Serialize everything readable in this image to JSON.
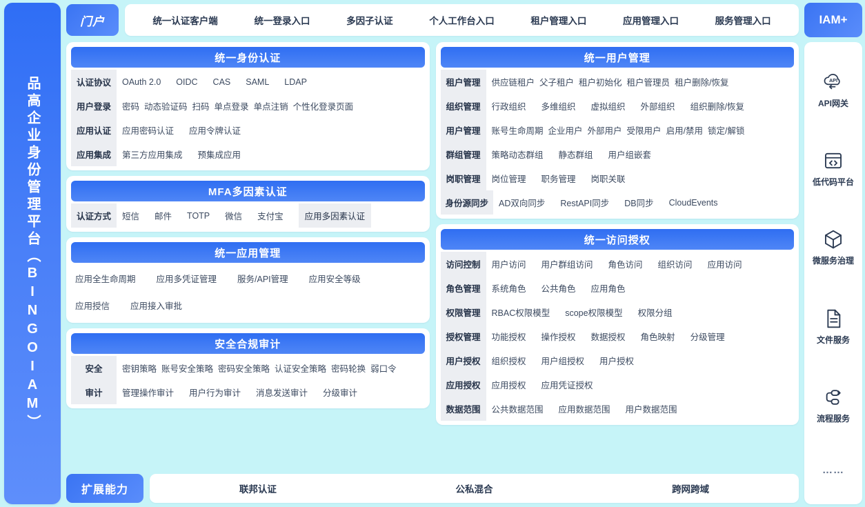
{
  "brand": {
    "vertical_title": "品高企业身份管理平台（BINGOIAM）"
  },
  "topnav": {
    "portal_label": "门户",
    "items": [
      {
        "label": "统一认证客户端"
      },
      {
        "label": "统一登录入口"
      },
      {
        "label": "多因子认证"
      },
      {
        "label": "个人工作台入口"
      },
      {
        "label": "租户管理入口"
      },
      {
        "label": "应用管理入口"
      },
      {
        "label": "服务管理入口"
      }
    ],
    "iam_label": "IAM+"
  },
  "left_column": [
    {
      "title": "统一身份认证",
      "rows": [
        {
          "label": "认证协议",
          "items": [
            "OAuth 2.0",
            "OIDC",
            "CAS",
            "SAML",
            "LDAP"
          ],
          "spacing": "wide"
        },
        {
          "label": "用户登录",
          "items": [
            "密码",
            "动态验证码",
            "扫码",
            "单点登录",
            "单点注销",
            "个性化登录页面"
          ],
          "spacing": "tight"
        },
        {
          "label": "应用认证",
          "items": [
            "应用密码认证",
            "应用令牌认证"
          ],
          "spacing": "wide"
        },
        {
          "label": "应用集成",
          "items": [
            "第三方应用集成",
            "预集成应用"
          ],
          "spacing": "wide"
        }
      ]
    },
    {
      "title": "MFA多因素认证",
      "rows": [
        {
          "label": "认证方式",
          "items": [
            "短信",
            "邮件",
            "TOTP",
            "微信",
            "支付宝"
          ],
          "chip_items": [
            "应用多因素认证"
          ],
          "spacing": "wide"
        }
      ]
    },
    {
      "title": "统一应用管理",
      "plain_rows": [
        {
          "items": [
            "应用全生命周期",
            "应用多凭证管理",
            "服务/API管理",
            "应用安全等级"
          ]
        },
        {
          "items": [
            "应用授信",
            "应用接入审批"
          ]
        }
      ]
    },
    {
      "title": "安全合规审计",
      "rows": [
        {
          "label": "安全",
          "items": [
            "密钥策略",
            "账号安全策略",
            "密码安全策略",
            "认证安全策略",
            "密码轮换",
            "弱口令"
          ],
          "spacing": "tight"
        },
        {
          "label": "审计",
          "items": [
            "管理操作审计",
            "用户行为审计",
            "消息发送审计",
            "分级审计"
          ],
          "spacing": "wide"
        }
      ]
    }
  ],
  "right_column": [
    {
      "title": "统一用户管理",
      "rows": [
        {
          "label": "租户管理",
          "items": [
            "供应链租户",
            "父子租户",
            "租户初始化",
            "租户管理员",
            "租户删除/恢复"
          ],
          "spacing": "tight"
        },
        {
          "label": "组织管理",
          "items": [
            "行政组织",
            "多维组织",
            "虚拟组织",
            "外部组织",
            "组织删除/恢复"
          ],
          "spacing": "wide"
        },
        {
          "label": "用户管理",
          "items": [
            "账号生命周期",
            "企业用户",
            "外部用户",
            "受限用户",
            "启用/禁用",
            "锁定/解锁"
          ],
          "spacing": "tight"
        },
        {
          "label": "群组管理",
          "items": [
            "策略动态群组",
            "静态群组",
            "用户组嵌套"
          ],
          "spacing": "wide"
        },
        {
          "label": "岗职管理",
          "items": [
            "岗位管理",
            "职务管理",
            "岗职关联"
          ],
          "spacing": "wide"
        },
        {
          "label": "身份源同步",
          "items": [
            "AD双向同步",
            "RestAPI同步",
            "DB同步",
            "CloudEvents"
          ],
          "spacing": "wide"
        }
      ]
    },
    {
      "title": "统一访问授权",
      "rows": [
        {
          "label": "访问控制",
          "items": [
            "用户访问",
            "用户群组访问",
            "角色访问",
            "组织访问",
            "应用访问"
          ],
          "spacing": "wide"
        },
        {
          "label": "角色管理",
          "items": [
            "系统角色",
            "公共角色",
            "应用角色"
          ],
          "spacing": "wide"
        },
        {
          "label": "权限管理",
          "items": [
            "RBAC权限模型",
            "scope权限模型",
            "权限分组"
          ],
          "spacing": "wide"
        },
        {
          "label": "授权管理",
          "items": [
            "功能授权",
            "操作授权",
            "数据授权",
            "角色映射",
            "分级管理"
          ],
          "spacing": "wide"
        },
        {
          "label": "用户授权",
          "items": [
            "组织授权",
            "用户组授权",
            "用户授权"
          ],
          "spacing": "wide"
        },
        {
          "label": "应用授权",
          "items": [
            "应用授权",
            "应用凭证授权"
          ],
          "spacing": "wide"
        },
        {
          "label": "数据范围",
          "items": [
            "公共数据范围",
            "应用数据范围",
            "用户数据范围"
          ],
          "spacing": "wide"
        }
      ]
    }
  ],
  "bottom": {
    "ext_label": "扩展能力",
    "items": [
      {
        "label": "联邦认证"
      },
      {
        "label": "公私混合"
      },
      {
        "label": "跨网跨域"
      }
    ]
  },
  "services": [
    {
      "label": "API网关",
      "icon": "api-gateway-icon"
    },
    {
      "label": "低代码平台",
      "icon": "low-code-icon"
    },
    {
      "label": "微服务治理",
      "icon": "microservice-icon"
    },
    {
      "label": "文件服务",
      "icon": "file-service-icon"
    },
    {
      "label": "流程服务",
      "icon": "process-service-icon"
    },
    {
      "label": "……",
      "icon": "more-icon"
    }
  ],
  "colors": {
    "page_bg": "#c6f4f8",
    "brand_blue": "#2f6ef5",
    "accent_blue": "#4f86f6",
    "chip_gray": "#eceef2",
    "text_dark": "#27344a"
  }
}
